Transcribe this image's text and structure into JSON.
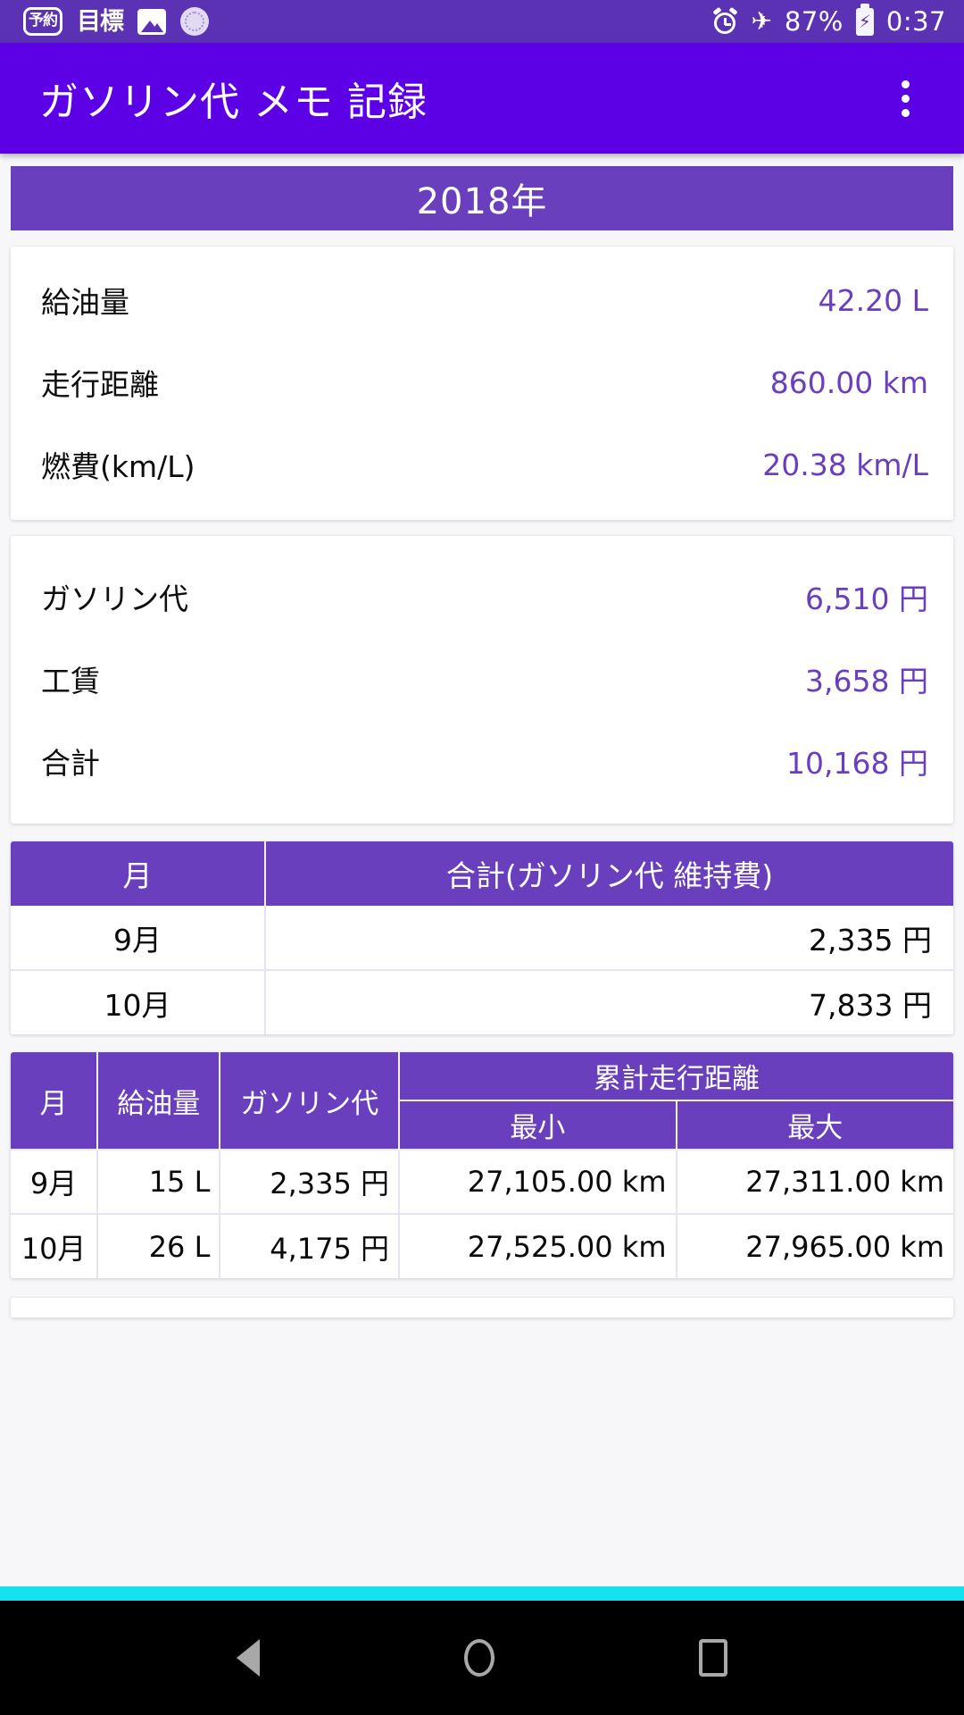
{
  "status_bar": {
    "left_icons": [
      "reservation-icon",
      "target-icon",
      "photo-icon",
      "sun-icon"
    ],
    "reservation_label": "予約",
    "target_label": "目標",
    "right_icons": [
      "alarm-icon",
      "airplane-mode-icon",
      "battery-charging-icon"
    ],
    "battery_percent": "87%",
    "clock": "0:37",
    "airplane_glyph": "✈",
    "bolt_glyph": "⚡",
    "bg_color": "#5c32b4"
  },
  "app_bar": {
    "title": "ガソリン代 メモ 記録",
    "overflow_menu_label": "more-options",
    "bg_color": "#5c00e6"
  },
  "year_banner": {
    "label": "2018年",
    "bg_color": "#6a3fbe"
  },
  "summary_card": {
    "rows": [
      {
        "label": "給油量",
        "value": "42.20 L"
      },
      {
        "label": "走行距離",
        "value": "860.00 km"
      },
      {
        "label": "燃費(km/L)",
        "value": "20.38 km/L"
      }
    ]
  },
  "cost_card": {
    "rows": [
      {
        "label": "ガソリン代",
        "value": "6,510 円"
      },
      {
        "label": "工賃",
        "value": "3,658 円"
      },
      {
        "label": "合計",
        "value": "10,168 円"
      }
    ]
  },
  "monthly_total_table": {
    "headers": [
      "月",
      "合計(ガソリン代 維持費)"
    ],
    "rows": [
      {
        "month": "9月",
        "total": "2,335 円"
      },
      {
        "month": "10月",
        "total": "7,833 円"
      }
    ]
  },
  "monthly_detail_table": {
    "headers": {
      "month": "月",
      "fuel": "給油量",
      "gas_cost": "ガソリン代",
      "odometer_group": "累計走行距離",
      "min": "最小",
      "max": "最大"
    },
    "rows": [
      {
        "month": "9月",
        "fuel": "15 L",
        "gas_cost": "2,335 円",
        "min": "27,105.00 km",
        "max": "27,311.00 km"
      },
      {
        "month": "10月",
        "fuel": "26 L",
        "gas_cost": "4,175 円",
        "min": "27,525.00 km",
        "max": "27,965.00 km"
      }
    ]
  },
  "nav_bar": {
    "back_label": "back",
    "home_label": "home",
    "recents_label": "recent-apps",
    "accent_strip_color": "#16e1f0"
  },
  "theme": {
    "accent_purple": "#6a3fbe",
    "appbar_purple": "#5c00e6",
    "page_bg": "#f7f7f9"
  }
}
